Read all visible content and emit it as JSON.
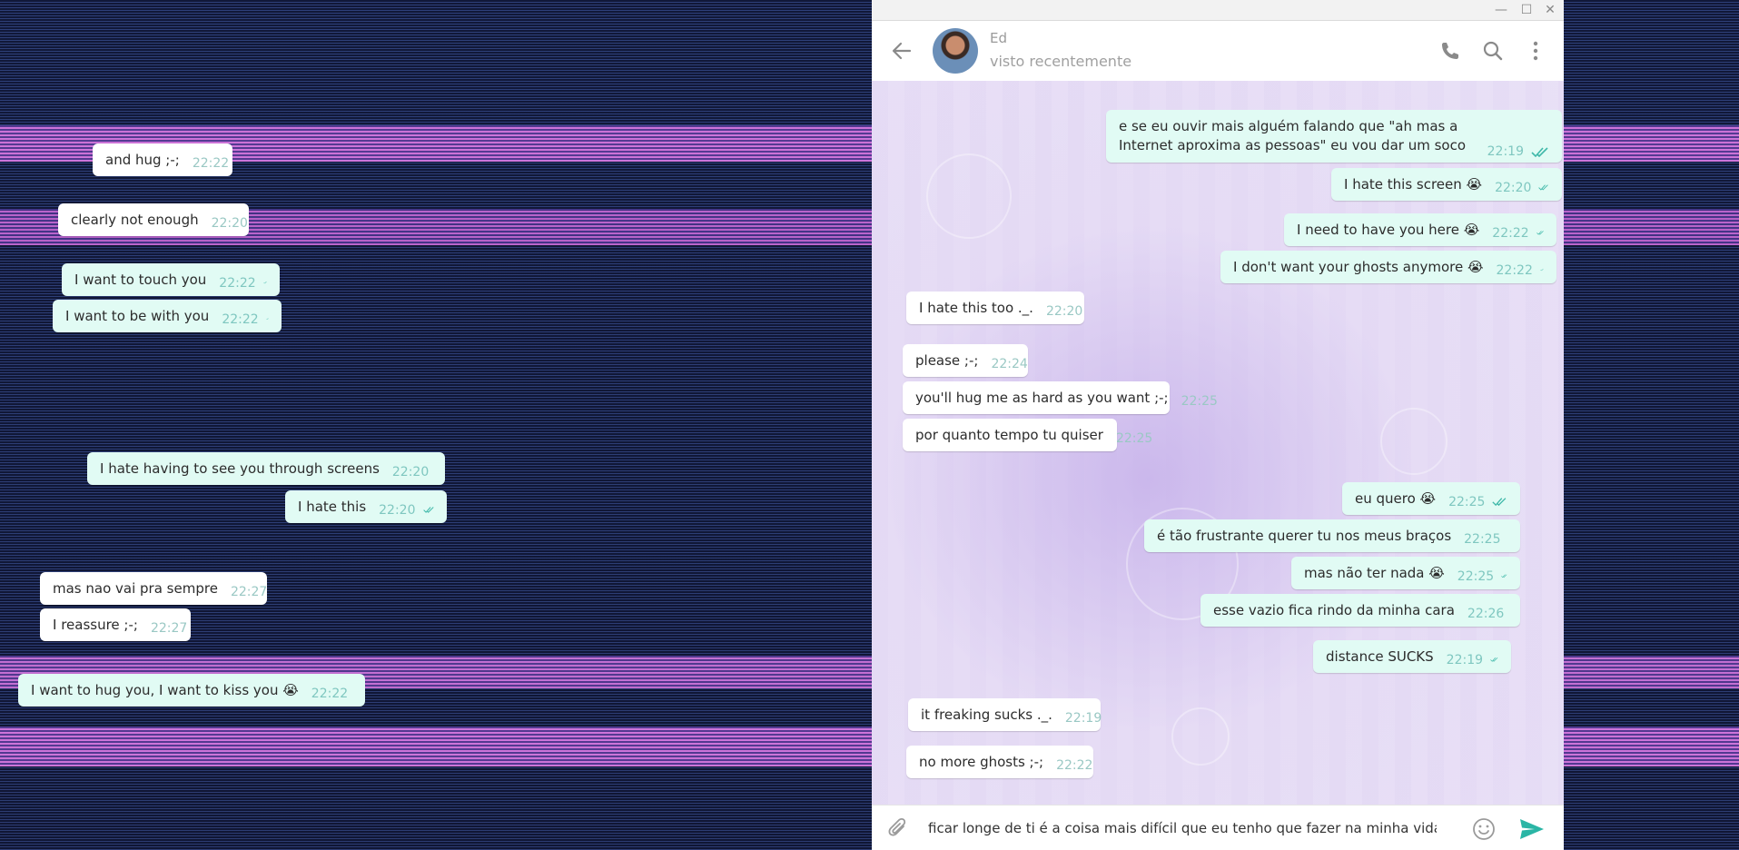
{
  "colors": {
    "background": "#1b2448",
    "glitch_band": "#e07ce8",
    "incoming_bubble": "#ffffff",
    "outgoing_bubble": "#e1fbf4",
    "time_text": "#7fc7c0",
    "accent": "#2ab5a5"
  },
  "background_messages": [
    {
      "text": "and hug ;-;",
      "time": "22:22",
      "dir": "in"
    },
    {
      "text": "clearly not enough",
      "time": "22:20",
      "dir": "in"
    },
    {
      "text": "I want to touch you",
      "time": "22:22",
      "dir": "out"
    },
    {
      "text": "I want to be with you",
      "time": "22:22",
      "dir": "out"
    },
    {
      "text": "I hate having to see you through screens",
      "time": "22:20",
      "dir": "out"
    },
    {
      "text": "I hate this",
      "time": "22:20",
      "dir": "out"
    },
    {
      "text": "mas nao vai pra sempre",
      "time": "22:27",
      "dir": "in"
    },
    {
      "text": "I reassure ;-;",
      "time": "22:27",
      "dir": "in"
    },
    {
      "text": "I want to hug you, I want to kiss you 😭",
      "time": "22:22",
      "dir": "out"
    }
  ],
  "window": {
    "controls": {
      "minimize": "—",
      "maximize": "☐",
      "close": "✕"
    }
  },
  "header": {
    "contact_name": "Ed",
    "status": "visto recentemente",
    "icons": [
      "back-arrow-icon",
      "phone-icon",
      "search-icon",
      "more-vertical-icon"
    ]
  },
  "messages": [
    {
      "text": "e se eu ouvir mais alguém falando que \"ah mas a Internet aproxima as pessoas\" eu vou dar um soco",
      "time": "22:19",
      "dir": "out"
    },
    {
      "text": "I hate this screen 😭",
      "time": "22:20",
      "dir": "out"
    },
    {
      "text": "I need  to have you here 😭",
      "time": "22:22",
      "dir": "out"
    },
    {
      "text": "I don't want your ghosts anymore 😭",
      "time": "22:22",
      "dir": "out"
    },
    {
      "text": "I hate this too ._.",
      "time": "22:20",
      "dir": "in"
    },
    {
      "text": "please ;-;",
      "time": "22:24",
      "dir": "in"
    },
    {
      "text": "you'll hug me as hard as you want ;-;",
      "time": "22:25",
      "dir": "in"
    },
    {
      "text": "por quanto tempo tu quiser",
      "time": "22:25",
      "dir": "in"
    },
    {
      "text": "eu quero 😭",
      "time": "22:25",
      "dir": "out"
    },
    {
      "text": "é tão frustrante querer tu nos meus braços",
      "time": "22:25",
      "dir": "out"
    },
    {
      "text": "mas não ter nada 😭",
      "time": "22:25",
      "dir": "out"
    },
    {
      "text": "esse vazio fica rindo da minha cara",
      "time": "22:26",
      "dir": "out"
    },
    {
      "text": "distance SUCKS",
      "time": "22:19",
      "dir": "out"
    },
    {
      "text": "it freaking sucks ._.",
      "time": "22:19",
      "dir": "in"
    },
    {
      "text": "no more ghosts ;-;",
      "time": "22:22",
      "dir": "in"
    }
  ],
  "input": {
    "value": "ficar longe de ti é a coisa mais difícil que eu tenho que fazer na minha vida",
    "icons": [
      "paperclip-icon",
      "emoji-icon",
      "send-icon"
    ]
  }
}
